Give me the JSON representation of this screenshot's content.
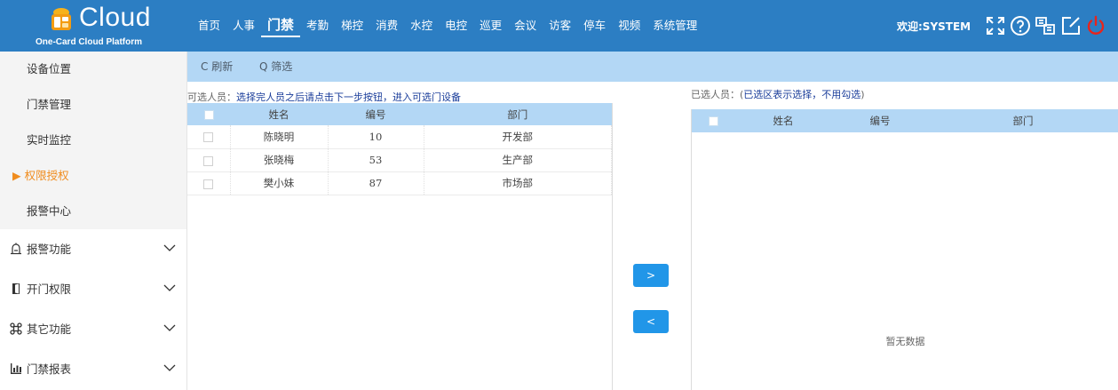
{
  "brand": {
    "title": "Cloud",
    "subtitle": "One-Card Cloud Platform",
    "bar_color": "#2c7ec3"
  },
  "nav": {
    "items": [
      "首页",
      "人事",
      "门禁",
      "考勤",
      "梯控",
      "消费",
      "水控",
      "电控",
      "巡更",
      "会议",
      "访客",
      "停车",
      "视频",
      "系统管理"
    ],
    "active": "门禁"
  },
  "header": {
    "welcome": "欢迎:SYSTEM",
    "icons": [
      "fullscreen-icon",
      "help-icon",
      "switch-icon",
      "edit-icon",
      "power-icon"
    ],
    "power_color": "#e8241c"
  },
  "sidebar": {
    "sub_items": [
      {
        "label": "设备位置"
      },
      {
        "label": "门禁管理"
      },
      {
        "label": "实时监控"
      },
      {
        "label": "▶ 权限授权"
      },
      {
        "label": "报警中心"
      }
    ],
    "active_sub": "权限授权",
    "active_color": "#f08c1d",
    "menu": [
      {
        "label": "报警功能",
        "icon": "alarm-icon"
      },
      {
        "label": "开门权限",
        "icon": "door-icon"
      },
      {
        "label": "其它功能",
        "icon": "command-icon"
      },
      {
        "label": "门禁报表",
        "icon": "report-icon"
      }
    ]
  },
  "toolbar": {
    "refresh_label": "C 刷新",
    "filter_label": "Q 筛选",
    "bg_color": "#b3d7f5"
  },
  "left_panel": {
    "hint_prefix": "可选人员：",
    "hint_text": "选择完人员之后请点击下一步按钮，进入可选门设备",
    "columns": [
      "姓名",
      "编号",
      "部门"
    ],
    "rows": [
      {
        "name": "陈晓明",
        "id": "10",
        "dept": "开发部"
      },
      {
        "name": "张晓梅",
        "id": "53",
        "dept": "生产部"
      },
      {
        "name": "樊小妹",
        "id": "87",
        "dept": "市场部"
      }
    ]
  },
  "move_buttons": {
    "add_label": ">",
    "remove_label": "<",
    "color": "#2196e8"
  },
  "right_panel": {
    "hint_prefix": "已选人员：(",
    "hint_text": "已选区表示选择，不用勾选",
    "hint_suffix": ")",
    "columns": [
      "姓名",
      "编号",
      "部门"
    ],
    "empty_text": "暂无数据"
  }
}
